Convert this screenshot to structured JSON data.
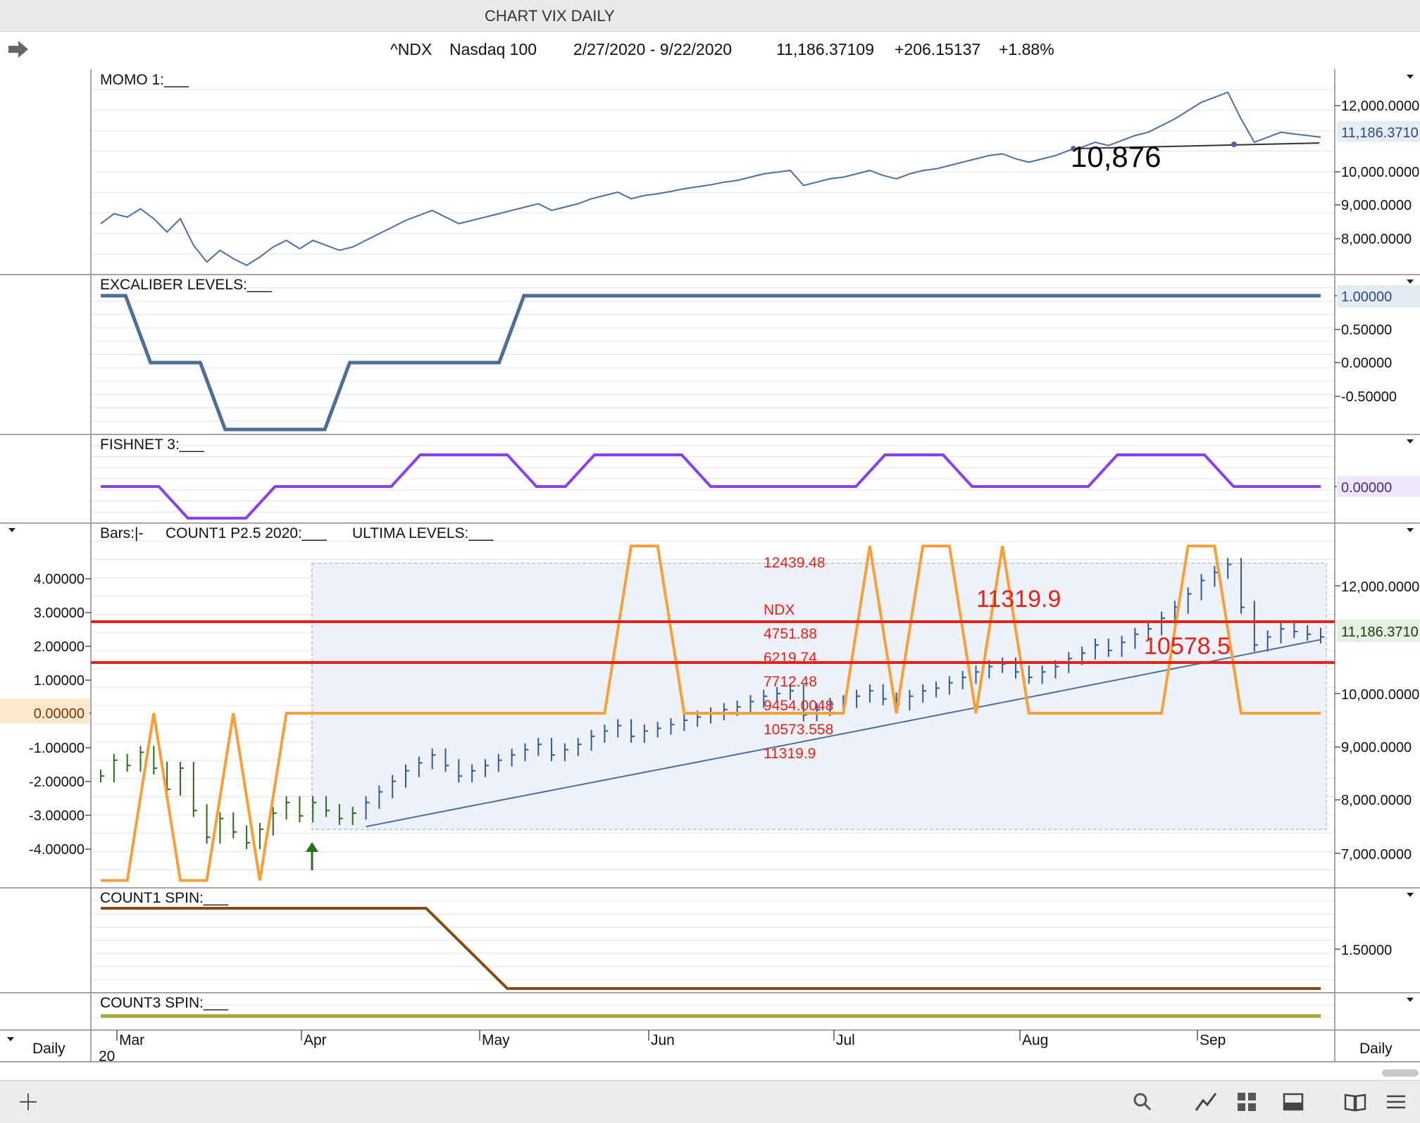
{
  "window": {
    "title": "CHART VIX DAILY"
  },
  "quote": {
    "symbol": "^NDX",
    "name": "Nasdaq 100",
    "range": "2/27/2020 - 9/22/2020",
    "last": "11,186.37109",
    "change": "+206.15137",
    "pct": "+1.88%"
  },
  "colors": {
    "price_line": "#4a6fa5",
    "excaliber": "#4d6f96",
    "fishnet": "#8a3ff0",
    "ultima": "#f5a03a",
    "red_level": "#e4231b",
    "count1_spin": "#8b4a14",
    "count3_spin": "#a7a53a",
    "bars_up": "#2a6e1c",
    "bars_down": "#2c5aa0"
  },
  "panels": {
    "momo": {
      "label": "MOMO 1:___",
      "annotation": "10,876",
      "ticks": [
        "12,000.0000",
        "10,000.0000",
        "9,000.0000",
        "8,000.0000"
      ],
      "last_badge": "11,186.3710"
    },
    "excaliber": {
      "label": "EXCALIBER LEVELS:___",
      "ticks": [
        "1.00000",
        "0.50000",
        "0.00000",
        "-0.50000"
      ]
    },
    "fishnet": {
      "label": "FISHNET 3:___",
      "ticks": [
        "0.00000"
      ]
    },
    "main": {
      "label_bars": "Bars:|-",
      "label_count1": "COUNT1 P2.5 2020:___",
      "label_ultima": "ULTIMA LEVELS:___",
      "left_ticks": [
        "4.00000",
        "3.00000",
        "2.00000",
        "1.00000",
        "0.00000",
        "-1.00000",
        "-2.00000",
        "-3.00000",
        "-4.00000"
      ],
      "right_ticks": [
        "12,000.0000",
        "10,000.0000",
        "9,000.0000",
        "8,000.0000",
        "7,000.0000"
      ],
      "last_badge": "11,186.3710",
      "big_upper": "11319.9",
      "big_lower": "10578.5",
      "level_list": [
        "12439.48",
        "NDX",
        "4751.88",
        "6219.74",
        "7712.48",
        "9454.0048",
        "10573.558",
        "11319.9"
      ]
    },
    "count1_spin": {
      "label": "COUNT1 SPIN:___",
      "ticks": [
        "1.50000"
      ]
    },
    "count3_spin": {
      "label": "COUNT3 SPIN:___"
    }
  },
  "time_axis": {
    "left_label": "Daily",
    "right_label": "Daily",
    "year": "20",
    "months": [
      "Mar",
      "Apr",
      "May",
      "Jun",
      "Jul",
      "Aug",
      "Sep"
    ]
  },
  "chart_data": [
    {
      "type": "line",
      "panel": "MOMO 1",
      "series": [
        {
          "values": [
            8450,
            8750,
            8650,
            8900,
            8600,
            8200,
            8600,
            7800,
            7300,
            7650,
            7400,
            7200,
            7450,
            7750,
            7950,
            7700,
            7950,
            7800,
            7650,
            7750,
            7950,
            8150,
            8350,
            8550,
            8700,
            8850,
            8650,
            8450,
            8550,
            8650,
            8750,
            8850,
            8950,
            9050,
            8850,
            8950,
            9050,
            9200,
            9300,
            9400,
            9200,
            9300,
            9350,
            9420,
            9500,
            9560,
            9620,
            9700,
            9750,
            9850,
            9950,
            10000,
            10050,
            9600,
            9700,
            9800,
            9850,
            9950,
            10050,
            9900,
            9800,
            9950,
            10050,
            10100,
            10200,
            10300,
            10400,
            10500,
            10550,
            10400,
            10300,
            10400,
            10500,
            10650,
            10750,
            10900,
            10800,
            10950,
            11100,
            11200,
            11400,
            11600,
            11850,
            12100,
            12250,
            12400,
            11600,
            10900,
            11050,
            11200,
            11150,
            11100,
            11050
          ]
        }
      ],
      "annotation_level": 10876
    },
    {
      "type": "line",
      "panel": "EXCALIBER LEVELS",
      "series": [
        {
          "values": [
            1,
            1,
            0,
            0,
            0,
            -1,
            -1,
            -1,
            -1,
            -1,
            0,
            0,
            0,
            0,
            0,
            0,
            0,
            1,
            1,
            1,
            1,
            1,
            1,
            1,
            1,
            1,
            1,
            1,
            1,
            1,
            1,
            1,
            1,
            1,
            1,
            1,
            1,
            1,
            1,
            1,
            1,
            1,
            1,
            1,
            1,
            1,
            1,
            1,
            1,
            1
          ]
        }
      ],
      "ylim": [
        -1,
        1
      ]
    },
    {
      "type": "line",
      "panel": "FISHNET 3",
      "series": [
        {
          "values": [
            0,
            0,
            0,
            -1,
            -1,
            -1,
            0,
            0,
            0,
            0,
            0,
            1,
            1,
            1,
            1,
            0,
            0,
            1,
            1,
            1,
            1,
            0,
            0,
            0,
            0,
            0,
            0,
            1,
            1,
            1,
            0,
            0,
            0,
            0,
            0,
            1,
            1,
            1,
            1,
            0,
            0,
            0,
            0
          ]
        }
      ]
    },
    {
      "type": "line",
      "panel": "ULTIMA LEVELS",
      "series": [
        {
          "values": [
            -5,
            -5,
            0,
            -5,
            -5,
            0,
            -5,
            0,
            0,
            0,
            0,
            0,
            0,
            0,
            0,
            0,
            0,
            0,
            0,
            0,
            5,
            5,
            0,
            0,
            0,
            0,
            0,
            0,
            0,
            5,
            0,
            5,
            5,
            0,
            5,
            0,
            0,
            0,
            0,
            0,
            0,
            5,
            5,
            0,
            0,
            0,
            0
          ]
        }
      ],
      "levels": [
        12439.48,
        11319.9,
        10578.5
      ],
      "ylim": [
        -5,
        5
      ]
    },
    {
      "type": "line",
      "panel": "COUNT1 SPIN",
      "series": [
        {
          "values": [
            2,
            2,
            2,
            2,
            2,
            1,
            1,
            1,
            1,
            1,
            1,
            1,
            1,
            1,
            1,
            1
          ]
        }
      ]
    }
  ]
}
